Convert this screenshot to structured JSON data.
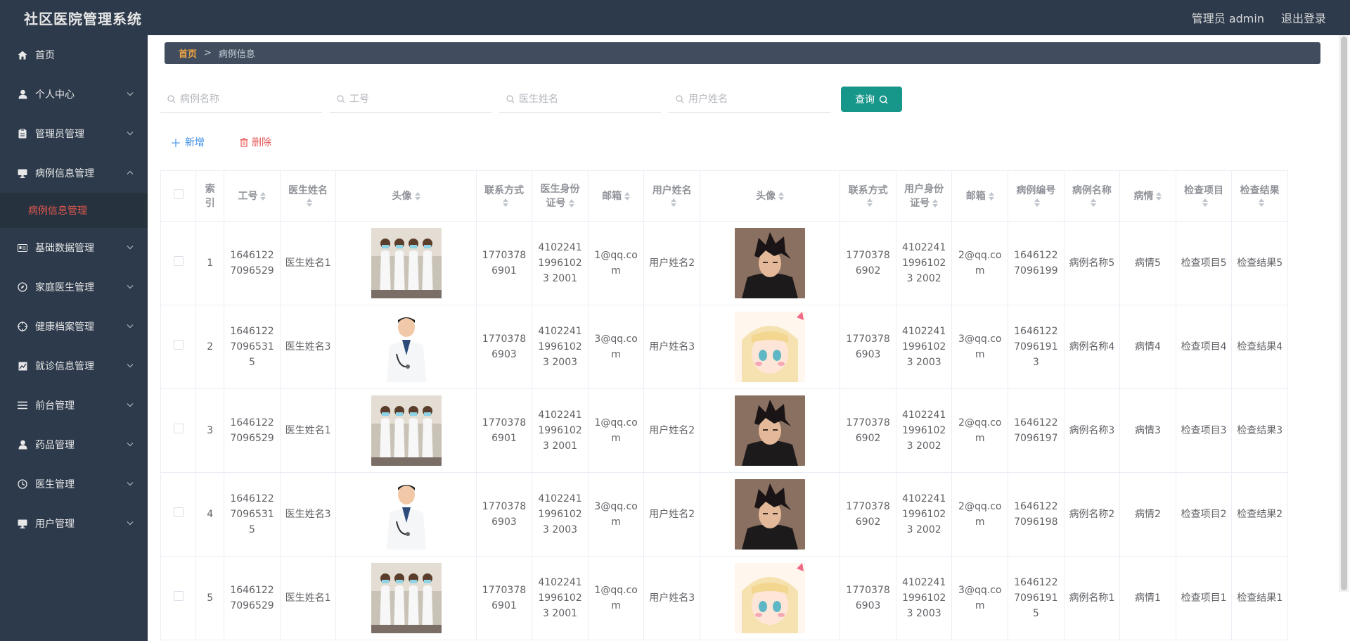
{
  "app": {
    "title": "社区医院管理系统"
  },
  "top": {
    "user_label": "管理员 admin",
    "logout_label": "退出登录"
  },
  "sidebar": {
    "items": [
      {
        "label": "首页",
        "icon": "home-icon",
        "has_children": false
      },
      {
        "label": "个人中心",
        "icon": "user-icon",
        "has_children": true
      },
      {
        "label": "管理员管理",
        "icon": "clipboard-icon",
        "has_children": true
      },
      {
        "label": "病例信息管理",
        "icon": "monitor-icon",
        "has_children": true,
        "expanded": true
      },
      {
        "label": "基础数据管理",
        "icon": "id-card-icon",
        "has_children": true
      },
      {
        "label": "家庭医生管理",
        "icon": "compass-icon",
        "has_children": true
      },
      {
        "label": "健康档案管理",
        "icon": "target-icon",
        "has_children": true
      },
      {
        "label": "就诊信息管理",
        "icon": "chart-icon",
        "has_children": true
      },
      {
        "label": "前台管理",
        "icon": "list-icon",
        "has_children": true
      },
      {
        "label": "药品管理",
        "icon": "user-icon",
        "has_children": true
      },
      {
        "label": "医生管理",
        "icon": "clock-icon",
        "has_children": true
      },
      {
        "label": "用户管理",
        "icon": "monitor-icon",
        "has_children": true
      }
    ],
    "active_sub": "病例信息管理"
  },
  "breadcrumb": {
    "home": "首页",
    "sep": ">",
    "current": "病例信息"
  },
  "search": {
    "case_name_placeholder": "病例名称",
    "job_no_placeholder": "工号",
    "doctor_name_placeholder": "医生姓名",
    "user_name_placeholder": "用户姓名",
    "query_label": "查询"
  },
  "actions": {
    "add_label": "新增",
    "delete_label": "删除"
  },
  "table": {
    "headers": {
      "index": "索引",
      "job_no": "工号",
      "doctor_name": "医生姓名",
      "doctor_avatar": "头像",
      "doctor_phone": "联系方式",
      "doctor_id": "医生身份证号",
      "doctor_email": "邮箱",
      "user_name": "用户姓名",
      "user_avatar": "头像",
      "user_phone": "联系方式",
      "user_id": "用户身份证号",
      "user_email": "邮箱",
      "case_no": "病例编号",
      "case_name": "病例名称",
      "condition": "病情",
      "exam_item": "检查项目",
      "exam_result": "检查结果"
    },
    "rows": [
      {
        "index": "1",
        "job_no": "16461227096529",
        "doctor_name": "医生姓名1",
        "doctor_avatar": "doctors-group",
        "doctor_phone": "17703786901",
        "doctor_id": "410224119961023 2001",
        "doctor_email": "1@qq.com",
        "user_name": "用户姓名2",
        "user_avatar": "dark-hair-man",
        "user_phone": "17703786902",
        "user_id": "410224119961023 2002",
        "user_email": "2@qq.com",
        "case_no": "16461227096199",
        "case_name": "病例名称5",
        "condition": "病情5",
        "exam_item": "检查项目5",
        "exam_result": "检查结果5"
      },
      {
        "index": "2",
        "job_no": "164612270965315",
        "doctor_name": "医生姓名3",
        "doctor_avatar": "male-doctor",
        "doctor_phone": "17703786903",
        "doctor_id": "410224119961023 2003",
        "doctor_email": "3@qq.com",
        "user_name": "用户姓名3",
        "user_avatar": "anime-girl",
        "user_phone": "17703786903",
        "user_id": "410224119961023 2003",
        "user_email": "3@qq.com",
        "case_no": "164612270961913",
        "case_name": "病例名称4",
        "condition": "病情4",
        "exam_item": "检查项目4",
        "exam_result": "检查结果4"
      },
      {
        "index": "3",
        "job_no": "16461227096529",
        "doctor_name": "医生姓名1",
        "doctor_avatar": "doctors-group",
        "doctor_phone": "17703786901",
        "doctor_id": "410224119961023 2001",
        "doctor_email": "1@qq.com",
        "user_name": "用户姓名2",
        "user_avatar": "dark-hair-man",
        "user_phone": "17703786902",
        "user_id": "410224119961023 2002",
        "user_email": "2@qq.com",
        "case_no": "16461227096197",
        "case_name": "病例名称3",
        "condition": "病情3",
        "exam_item": "检查项目3",
        "exam_result": "检查结果3"
      },
      {
        "index": "4",
        "job_no": "164612270965315",
        "doctor_name": "医生姓名3",
        "doctor_avatar": "male-doctor",
        "doctor_phone": "17703786903",
        "doctor_id": "410224119961023 2003",
        "doctor_email": "3@qq.com",
        "user_name": "用户姓名2",
        "user_avatar": "dark-hair-man",
        "user_phone": "17703786902",
        "user_id": "410224119961023 2002",
        "user_email": "2@qq.com",
        "case_no": "16461227096198",
        "case_name": "病例名称2",
        "condition": "病情2",
        "exam_item": "检查项目2",
        "exam_result": "检查结果2"
      },
      {
        "index": "5",
        "job_no": "16461227096529",
        "doctor_name": "医生姓名1",
        "doctor_avatar": "doctors-group",
        "doctor_phone": "17703786901",
        "doctor_id": "410224119961023 2001",
        "doctor_email": "1@qq.com",
        "user_name": "用户姓名3",
        "user_avatar": "anime-girl",
        "user_phone": "17703786903",
        "user_id": "410224119961023 2003",
        "user_email": "3@qq.com",
        "case_no": "164612270961915",
        "case_name": "病例名称1",
        "condition": "病情1",
        "exam_item": "检查项目1",
        "exam_result": "检查结果1"
      }
    ]
  },
  "colors": {
    "sidebar_bg": "#2d3a4b",
    "accent": "#17968a",
    "active_menu": "#e0584f",
    "home_crumb": "#f0a443"
  }
}
